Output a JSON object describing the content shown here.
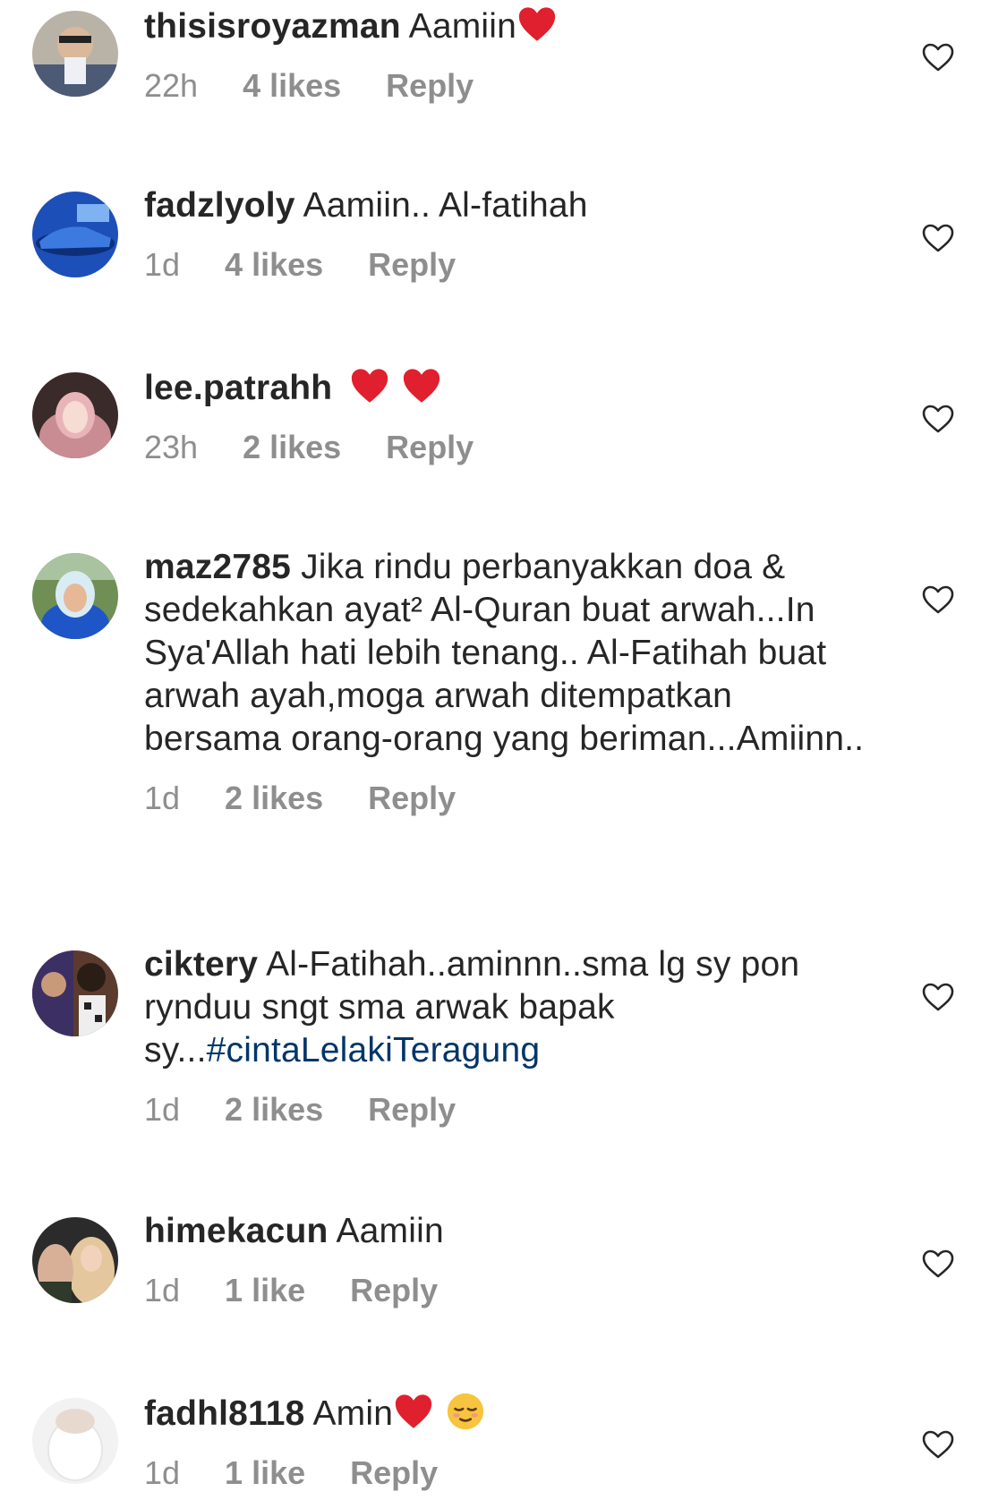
{
  "comments": [
    {
      "username": "thisisroyazman",
      "text": "Aamiin",
      "emojis_after": [
        "red-heart"
      ],
      "time": "22h",
      "likes": "4 likes",
      "reply": "Reply",
      "avatar": "avatar-thisisroyazman"
    },
    {
      "username": "fadzlyoly",
      "text": "Aamiin.. Al-fatihah",
      "time": "1d",
      "likes": "4 likes",
      "reply": "Reply",
      "avatar": "avatar-fadzlyoly"
    },
    {
      "username": "lee.patrahh",
      "text": "",
      "emojis_after": [
        "red-heart",
        "red-heart"
      ],
      "time": "23h",
      "likes": "2 likes",
      "reply": "Reply",
      "avatar": "avatar-lee-patrahh"
    },
    {
      "username": "maz2785",
      "text": "Jika rindu perbanyakkan doa & sedekahkan ayat² Al-Quran buat arwah...In Sya'Allah hati lebih tenang.. Al-Fatihah buat arwah ayah,moga arwah ditempatkan bersama orang-orang yang beriman...Amiinn..",
      "time": "1d",
      "likes": "2 likes",
      "reply": "Reply",
      "avatar": "avatar-maz2785"
    },
    {
      "username": "ciktery",
      "text": "Al-Fatihah..aminnn..sma lg sy pon rynduu sngt sma arwak bapak sy...",
      "hashtag": "#cintaLelakiTeragung",
      "time": "1d",
      "likes": "2 likes",
      "reply": "Reply",
      "avatar": "avatar-ciktery"
    },
    {
      "username": "himekacun",
      "text": "Aamiin",
      "time": "1d",
      "likes": "1 like",
      "reply": "Reply",
      "avatar": "avatar-himekacun"
    },
    {
      "username": "fadhl8118",
      "text": "Amin",
      "emojis_after": [
        "red-heart",
        "relieved-face"
      ],
      "time": "1d",
      "likes": "1 like",
      "reply": "Reply",
      "avatar": "avatar-fadhl8118"
    }
  ],
  "icons": {
    "like": "heart-outline-icon",
    "emoji_heart": "red-heart",
    "emoji_face": "relieved-face"
  },
  "colors": {
    "text": "#262626",
    "meta": "#8e8e8e",
    "hashtag": "#003569",
    "heart_emoji": "#e0202e"
  }
}
